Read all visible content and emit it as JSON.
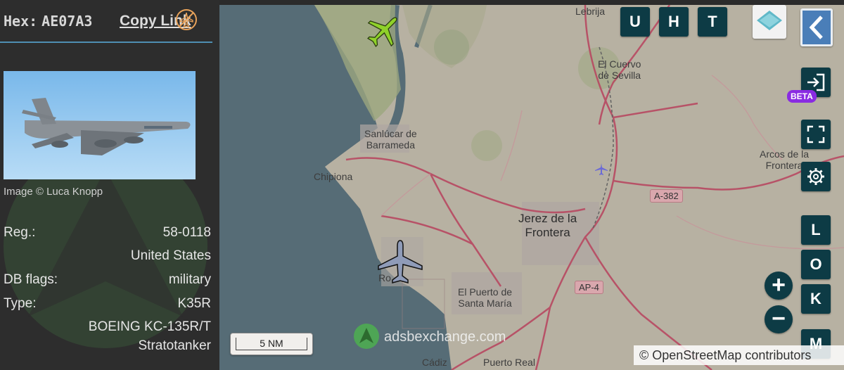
{
  "sidebar": {
    "hex_label": "Hex:",
    "hex_value": "AE07A3",
    "copy_link_label": "Copy Link",
    "photo_credit": "Image © Luca Knopp",
    "details": [
      {
        "label": "Reg.:",
        "value": "58-0118"
      },
      {
        "label": "",
        "value": "United States"
      },
      {
        "label": "DB flags:",
        "value": "military"
      },
      {
        "label": "Type:",
        "value": "K35R"
      },
      {
        "label": "",
        "value": "BOEING KC-135R/T"
      },
      {
        "label": "",
        "value": "Stratotanker"
      }
    ]
  },
  "map": {
    "places": {
      "lebrija": "Lebrija",
      "el_cuervo": "El Cuervo\nde Sevilla",
      "sanlucar": "Sanlúcar de\nBarrameda",
      "chipiona": "Chipiona",
      "arcos": "Arcos de la\nFrontera",
      "jerez": "Jerez de la\nFrontera",
      "rota": "Ro",
      "el_puerto": "El Puerto de\nSanta María",
      "cadiz": "Cádiz",
      "puerto_real": "Puerto Real"
    },
    "road_labels": {
      "a382": "A-382",
      "ap4": "AP-4"
    },
    "scale_label": "5 NM",
    "watermark": "adsbexchange.com",
    "attribution": "© OpenStreetMap contributors",
    "controls": {
      "top_buttons": [
        "U",
        "H",
        "T"
      ],
      "right_buttons": [
        "L",
        "O",
        "K",
        "M"
      ],
      "beta_label": "BETA",
      "zoom_in": "+",
      "zoom_out": "−"
    },
    "aircraft": [
      {
        "name": "green-aircraft",
        "color": "#8fd12a",
        "heading_deg": 45
      },
      {
        "name": "selected-aircraft",
        "color": "#8f9bb8",
        "heading_deg": 0
      },
      {
        "name": "small-aircraft",
        "color": "#6b6ad6",
        "heading_deg": 0
      }
    ]
  },
  "colors": {
    "button_dark": "#0d3b45",
    "divider_blue": "#4f8fb3",
    "beta_purple": "#8a2be2",
    "sea": "#5e7680",
    "land": "#c7c0b0",
    "road_primary": "#c8506a"
  }
}
